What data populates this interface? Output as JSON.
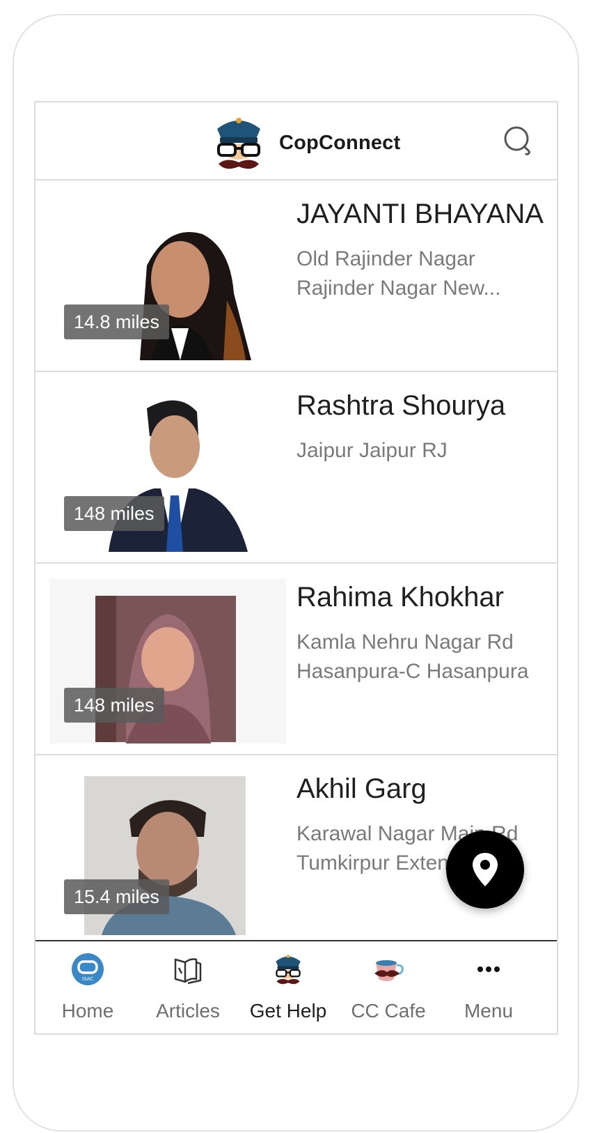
{
  "app": {
    "brand": "CopConnect"
  },
  "people": [
    {
      "name": "JAYANTI BHAYANA",
      "address_line1": "Old Rajinder Nagar",
      "address_line2": "Rajinder Nagar New...",
      "distance": "14.8 miles"
    },
    {
      "name": "Rashtra Shourya",
      "address_line1": "Jaipur Jaipur RJ",
      "address_line2": "",
      "distance": "148 miles"
    },
    {
      "name": "Rahima Khokhar",
      "address_line1": "Kamla Nehru Nagar Rd",
      "address_line2": "Hasanpura-C Hasanpura",
      "distance": "148 miles"
    },
    {
      "name": "Akhil Garg",
      "address_line1": "Karawal Nagar Main Rd",
      "address_line2": "Tumkirpur Extension",
      "distance": "15.4 miles"
    }
  ],
  "nav": {
    "items": [
      {
        "label": "Home",
        "icon": "home-icon"
      },
      {
        "label": "Articles",
        "icon": "book-icon"
      },
      {
        "label": "Get Help",
        "icon": "cop-icon",
        "active": true
      },
      {
        "label": "CC Cafe",
        "icon": "cafe-icon"
      },
      {
        "label": "Menu",
        "icon": "more-icon"
      }
    ]
  },
  "colors": {
    "accent": "#3b88c9",
    "fab": "#000000",
    "nav_border": "#333333"
  }
}
